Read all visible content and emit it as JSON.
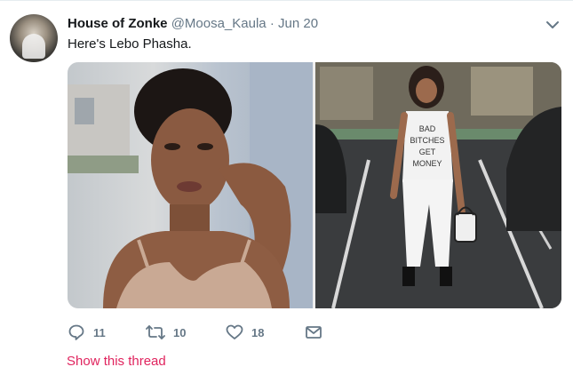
{
  "tweet": {
    "author_name": "House of Zonke",
    "handle": "@Moosa_Kaula",
    "separator": "·",
    "date": "Jun 20",
    "text": "Here's Lebo Phasha.",
    "photos": [
      {
        "subject": "woman-portrait"
      },
      {
        "subject": "woman-full-length",
        "shirt_text": [
          "BAD",
          "BITCHES",
          "GET",
          "MONEY"
        ]
      }
    ],
    "actions": {
      "reply_count": "11",
      "retweet_count": "10",
      "like_count": "18"
    },
    "show_thread_label": "Show this thread",
    "icons": [
      "reply-icon",
      "retweet-icon",
      "like-icon",
      "message-icon",
      "chevron-down-icon"
    ]
  },
  "colors": {
    "text": "#14171a",
    "secondary": "#657786",
    "link": "#e0245e",
    "border": "#e6ecf0"
  }
}
